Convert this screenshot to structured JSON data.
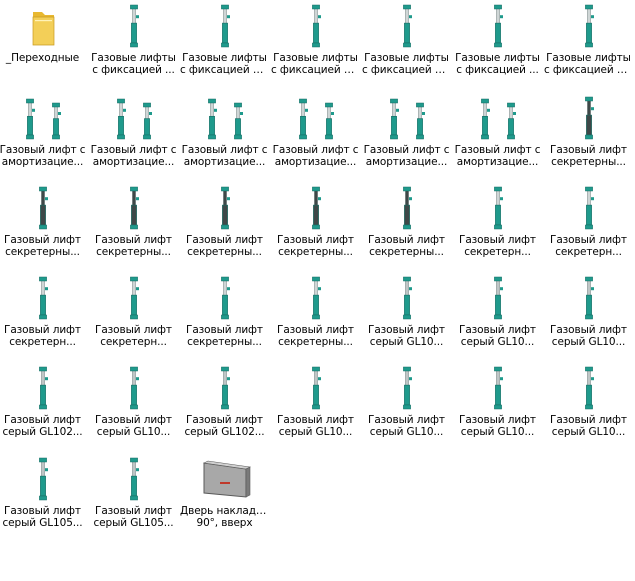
{
  "items": [
    {
      "kind": "folder",
      "icon": "folder-icon",
      "l1": "_Переходные",
      "l2": ""
    },
    {
      "kind": "lift",
      "icon": "gas-lift-icon",
      "l1": "Газовые лифты",
      "l2": "с фиксацией ..."
    },
    {
      "kind": "lift",
      "icon": "gas-lift-icon",
      "l1": "Газовые лифты",
      "l2": "с фиксацией п..."
    },
    {
      "kind": "lift",
      "icon": "gas-lift-icon",
      "l1": "Газовые лифты",
      "l2": "с фиксацией п..."
    },
    {
      "kind": "lift",
      "icon": "gas-lift-icon",
      "l1": "Газовые лифты",
      "l2": "с фиксацией п..."
    },
    {
      "kind": "lift",
      "icon": "gas-lift-icon",
      "l1": "Газовые лифты",
      "l2": "с фиксацией ..."
    },
    {
      "kind": "lift",
      "icon": "gas-lift-icon",
      "l1": "Газовые лифты",
      "l2": "с фиксацией п..."
    },
    {
      "kind": "pair",
      "icon": "gas-lift-pair-icon",
      "l1": "Газовый лифт с",
      "l2": "амортизацие..."
    },
    {
      "kind": "pair",
      "icon": "gas-lift-pair-icon",
      "l1": "Газовый лифт с",
      "l2": "амортизацие..."
    },
    {
      "kind": "pair",
      "icon": "gas-lift-pair-icon",
      "l1": "Газовый лифт с",
      "l2": "амортизацие..."
    },
    {
      "kind": "pair",
      "icon": "gas-lift-pair-icon",
      "l1": "Газовый лифт с",
      "l2": "амортизацие..."
    },
    {
      "kind": "pair",
      "icon": "gas-lift-pair-icon",
      "l1": "Газовый лифт с",
      "l2": "амортизацие..."
    },
    {
      "kind": "pair",
      "icon": "gas-lift-pair-icon",
      "l1": "Газовый лифт с",
      "l2": "амортизацие..."
    },
    {
      "kind": "dark",
      "icon": "gas-lift-icon",
      "l1": "Газовый лифт",
      "l2": "секретерны..."
    },
    {
      "kind": "dark",
      "icon": "gas-lift-icon",
      "l1": "Газовый лифт",
      "l2": "секретерны..."
    },
    {
      "kind": "dark",
      "icon": "gas-lift-icon",
      "l1": "Газовый лифт",
      "l2": "секретерны..."
    },
    {
      "kind": "dark",
      "icon": "gas-lift-icon",
      "l1": "Газовый лифт",
      "l2": "секретерны..."
    },
    {
      "kind": "dark",
      "icon": "gas-lift-icon",
      "l1": "Газовый лифт",
      "l2": "секретерны..."
    },
    {
      "kind": "dark",
      "icon": "gas-lift-icon",
      "l1": "Газовый лифт",
      "l2": "секретерны..."
    },
    {
      "kind": "lift",
      "icon": "gas-lift-icon",
      "l1": "Газовый лифт",
      "l2": "секретерн..."
    },
    {
      "kind": "lift",
      "icon": "gas-lift-icon",
      "l1": "Газовый лифт",
      "l2": "секретерн..."
    },
    {
      "kind": "lift",
      "icon": "gas-lift-icon",
      "l1": "Газовый лифт",
      "l2": "секретерн..."
    },
    {
      "kind": "lift",
      "icon": "gas-lift-icon",
      "l1": "Газовый лифт",
      "l2": "секретерн..."
    },
    {
      "kind": "lift",
      "icon": "gas-lift-icon",
      "l1": "Газовый лифт",
      "l2": "секретерны..."
    },
    {
      "kind": "lift",
      "icon": "gas-lift-icon",
      "l1": "Газовый лифт",
      "l2": "секретерны..."
    },
    {
      "kind": "grey",
      "icon": "gas-lift-icon",
      "l1": "Газовый лифт",
      "l2": "серый GL10..."
    },
    {
      "kind": "grey",
      "icon": "gas-lift-icon",
      "l1": "Газовый лифт",
      "l2": "серый GL10..."
    },
    {
      "kind": "grey",
      "icon": "gas-lift-icon",
      "l1": "Газовый лифт",
      "l2": "серый GL10..."
    },
    {
      "kind": "grey",
      "icon": "gas-lift-icon",
      "l1": "Газовый лифт",
      "l2": "серый GL102..."
    },
    {
      "kind": "grey",
      "icon": "gas-lift-icon",
      "l1": "Газовый лифт",
      "l2": "серый GL10..."
    },
    {
      "kind": "grey",
      "icon": "gas-lift-icon",
      "l1": "Газовый лифт",
      "l2": "серый GL102..."
    },
    {
      "kind": "grey",
      "icon": "gas-lift-icon",
      "l1": "Газовый лифт",
      "l2": "серый GL10..."
    },
    {
      "kind": "grey",
      "icon": "gas-lift-icon",
      "l1": "Газовый лифт",
      "l2": "серый GL10..."
    },
    {
      "kind": "grey",
      "icon": "gas-lift-icon",
      "l1": "Газовый лифт",
      "l2": "серый GL10..."
    },
    {
      "kind": "grey",
      "icon": "gas-lift-icon",
      "l1": "Газовый лифт",
      "l2": "серый GL10..."
    },
    {
      "kind": "grey",
      "icon": "gas-lift-icon",
      "l1": "Газовый лифт",
      "l2": "серый GL105..."
    },
    {
      "kind": "grey",
      "icon": "gas-lift-icon",
      "l1": "Газовый лифт",
      "l2": "серый GL105..."
    },
    {
      "kind": "door",
      "icon": "door-panel-icon",
      "l1": "Дверь накладн.,",
      "l2": "90°,  вверх"
    }
  ],
  "colors": {
    "teal": "#1f9a8c",
    "tealDark": "#146b62",
    "steel": "#cfd6d6",
    "dark": "#3e4848",
    "folder": "#f3cf58"
  }
}
